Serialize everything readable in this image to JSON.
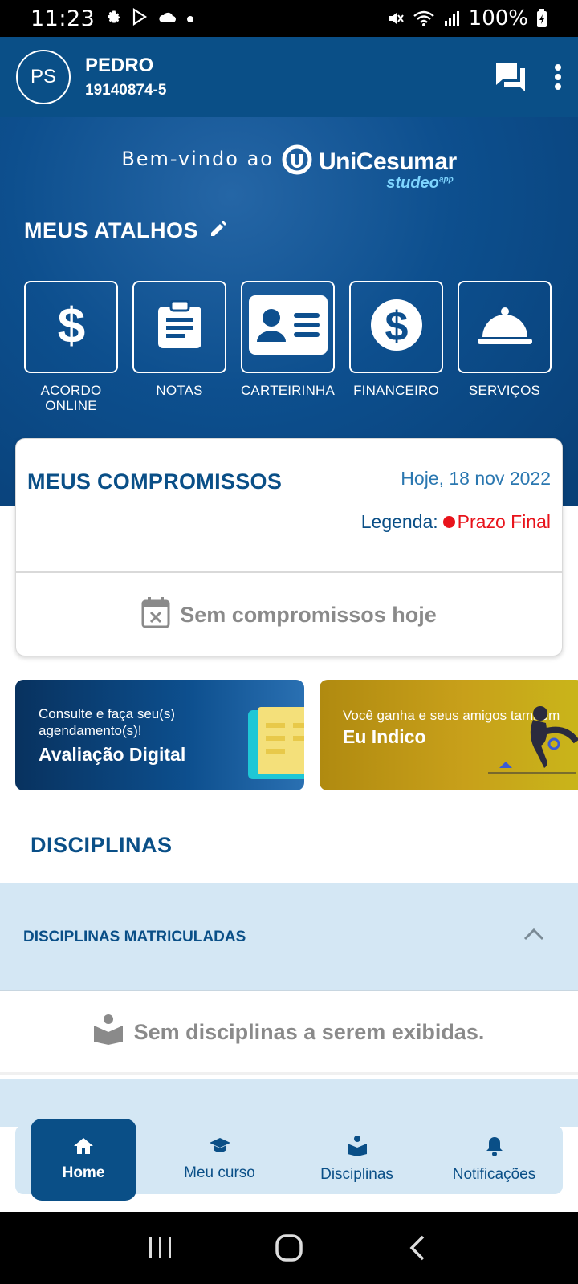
{
  "status_bar": {
    "time": "11:23",
    "battery": "100%",
    "left_icons": [
      "gear-icon",
      "play-store-icon",
      "cloud-icon",
      "dot-icon"
    ],
    "right_icons": [
      "mute-icon",
      "wifi-icon",
      "signal-icon",
      "battery-icon"
    ]
  },
  "header": {
    "avatar_initials": "PS",
    "user_name": "PEDRO",
    "user_id": "19140874-5",
    "actions": [
      "chat-icon",
      "more-vert-icon"
    ]
  },
  "hero": {
    "welcome_text": "Bem-vindo ao",
    "logo_brand": "UniCesumar",
    "logo_sub": "studeo",
    "logo_sub_suffix": "app",
    "shortcuts_title": "MEUS ATALHOS",
    "shortcuts": [
      {
        "label": "ACORDO ONLINE",
        "icon": "dollar-icon"
      },
      {
        "label": "NOTAS",
        "icon": "clipboard-icon"
      },
      {
        "label": "CARTEIRINHA",
        "icon": "id-card-icon"
      },
      {
        "label": "FINANCEIRO",
        "icon": "dollar-circle-icon"
      },
      {
        "label": "SERVIÇOS",
        "icon": "service-bell-icon"
      }
    ]
  },
  "commitments": {
    "title": "MEUS COMPROMISSOS",
    "date": "Hoje, 18 nov 2022",
    "legend_label": "Legenda:",
    "legend_value": "Prazo Final",
    "empty_text": "Sem compromissos hoje",
    "legend_color": "#e8131b"
  },
  "banners": [
    {
      "subtitle": "Consulte e faça seu(s) agendamento(s)!",
      "title": "Avaliação Digital"
    },
    {
      "subtitle": "Você ganha e seus amigos também",
      "title": "Eu Indico"
    }
  ],
  "disciplinas": {
    "section_title": "DISCIPLINAS",
    "accordion_title": "DISCIPLINAS MATRICULADAS",
    "empty_text": "Sem disciplinas a serem exibidas."
  },
  "bottom_nav": [
    {
      "label": "Home",
      "icon": "home-icon",
      "active": true
    },
    {
      "label": "Meu curso",
      "icon": "graduation-cap-icon",
      "active": false
    },
    {
      "label": "Disciplinas",
      "icon": "book-reader-icon",
      "active": false
    },
    {
      "label": "Notificações",
      "icon": "bell-icon",
      "active": false
    }
  ],
  "colors": {
    "primary": "#0a4f87",
    "accent_light": "#d4e7f4",
    "deadline_red": "#e8131b",
    "date_blue": "#2a77b0"
  }
}
